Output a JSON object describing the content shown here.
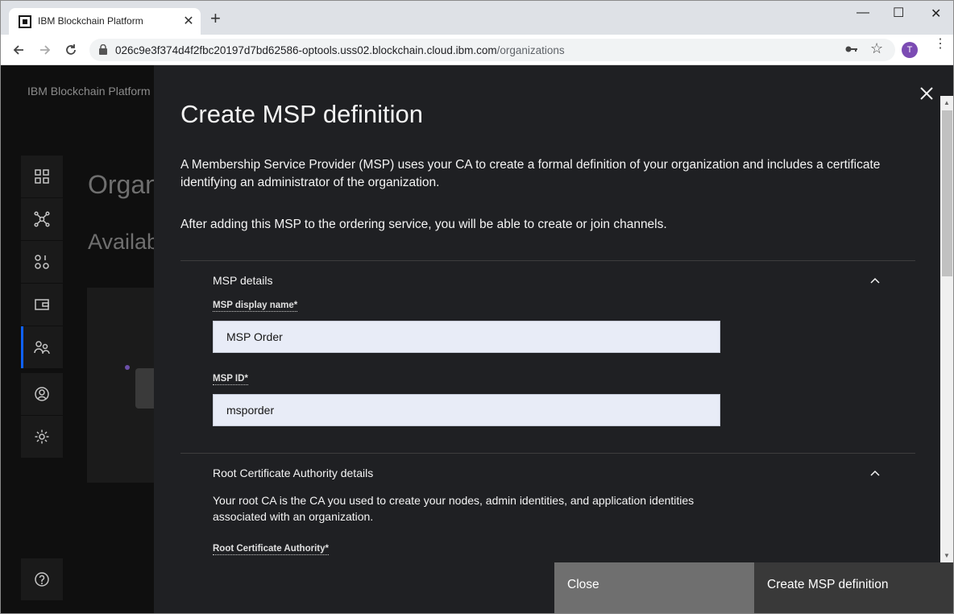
{
  "browser": {
    "tab_title": "IBM Blockchain Platform",
    "url_host": "026c9e3f374d4f2fbc20197d7bd62586-optools.uss02.blockchain.cloud.ibm.com",
    "url_path": "/organizations",
    "profile_initial": "T"
  },
  "app": {
    "brand": "IBM Blockchain Platform",
    "page_title_partial": "Organ",
    "page_subtitle_partial": "Availab",
    "nav_icons": [
      "dashboard-icon",
      "nodes-icon",
      "channels-icon",
      "wallet-icon",
      "organizations-icon",
      "users-icon",
      "settings-icon"
    ],
    "help_icon": "help-icon"
  },
  "panel": {
    "title": "Create MSP definition",
    "description": "A Membership Service Provider (MSP) uses your CA to create a formal definition of your organization and includes a certificate identifying an administrator of the organization.",
    "description2": "After adding this MSP to the ordering service, you will be able to create or join channels.",
    "msp_section": {
      "title": "MSP details",
      "display_name_label": "MSP display name*",
      "display_name_value": "MSP Order",
      "msp_id_label": "MSP ID*",
      "msp_id_value": "msporder"
    },
    "ca_section": {
      "title": "Root Certificate Authority details",
      "description": "Your root CA is the CA you used to create your nodes, admin identities, and application identities associated with an organization.",
      "root_ca_label": "Root Certificate Authority*"
    },
    "footer": {
      "close_label": "Close",
      "create_label": "Create MSP definition"
    }
  },
  "colors": {
    "accent": "#0f62fe",
    "panel_bg": "#1f2023",
    "close_button": "#6f6f6f",
    "create_button": "#393939"
  }
}
